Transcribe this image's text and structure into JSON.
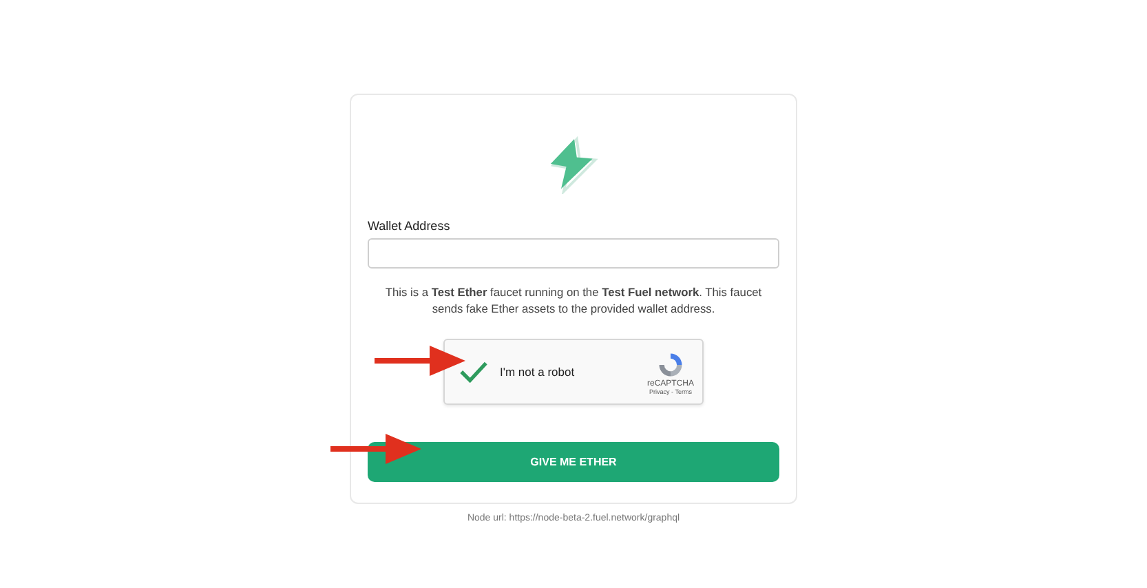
{
  "form": {
    "wallet_label": "Wallet Address",
    "description": "This is a **Test Ether** faucet running on the **Test Fuel network**. This faucet sends fake Ether assets to the provided wallet address.",
    "captcha": {
      "label": "I'm not a robot",
      "checked": true,
      "brand": "reCAPTCHA",
      "links": "Privacy - Terms"
    },
    "submit_button": "GIVE ME ETHER"
  },
  "footer": {
    "node_url": "Node url: https://node-beta-2.fuel.network/graphql"
  }
}
